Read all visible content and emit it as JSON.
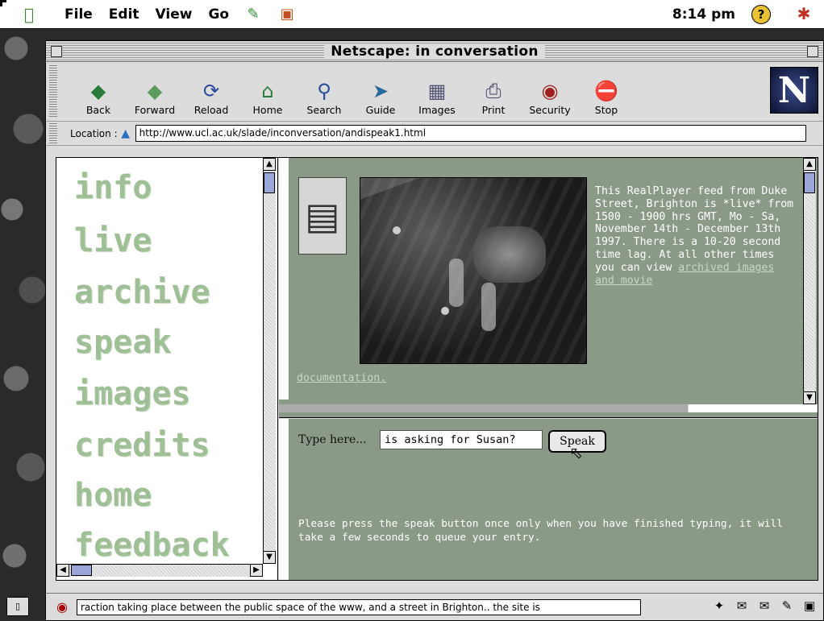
{
  "menubar": {
    "items": [
      "File",
      "Edit",
      "View",
      "Go"
    ],
    "clock": "8:14 pm"
  },
  "window": {
    "title": "Netscape: in conversation"
  },
  "toolbar": {
    "buttons": [
      {
        "label": "Back",
        "icon": "back-arrow-icon"
      },
      {
        "label": "Forward",
        "icon": "forward-arrow-icon"
      },
      {
        "label": "Reload",
        "icon": "reload-icon"
      },
      {
        "label": "Home",
        "icon": "home-icon"
      },
      {
        "label": "Search",
        "icon": "search-icon"
      },
      {
        "label": "Guide",
        "icon": "guide-icon"
      },
      {
        "label": "Images",
        "icon": "images-icon"
      },
      {
        "label": "Print",
        "icon": "print-icon"
      },
      {
        "label": "Security",
        "icon": "security-lock-icon"
      },
      {
        "label": "Stop",
        "icon": "stop-icon"
      }
    ]
  },
  "location": {
    "label": "Location :",
    "url": "http://www.ucl.ac.uk/slade/inconversation/andispeak1.html"
  },
  "nav": {
    "items": [
      "info",
      "live",
      "archive",
      "speak",
      "images",
      "credits",
      "home",
      "feedback"
    ]
  },
  "topframe": {
    "description": "This RealPlayer feed from Duke Street, Brighton is *live* from 1500 - 1900 hrs GMT, Mo - Sa, November 14th - December 13th 1997. There is a 10-20 second time lag. At all other times you can view",
    "archive_link": "archived images and movie",
    "doc_link": "documentation."
  },
  "speakframe": {
    "prompt": "Type here...",
    "input_value": "is asking for Susan?",
    "button_label": "Speak",
    "note": "Please press the speak button once only when you have finished typing, it will take a few seconds to queue your entry."
  },
  "status": {
    "text": "raction taking place between the public space of the www, and a street in Brighton.. the site is"
  }
}
